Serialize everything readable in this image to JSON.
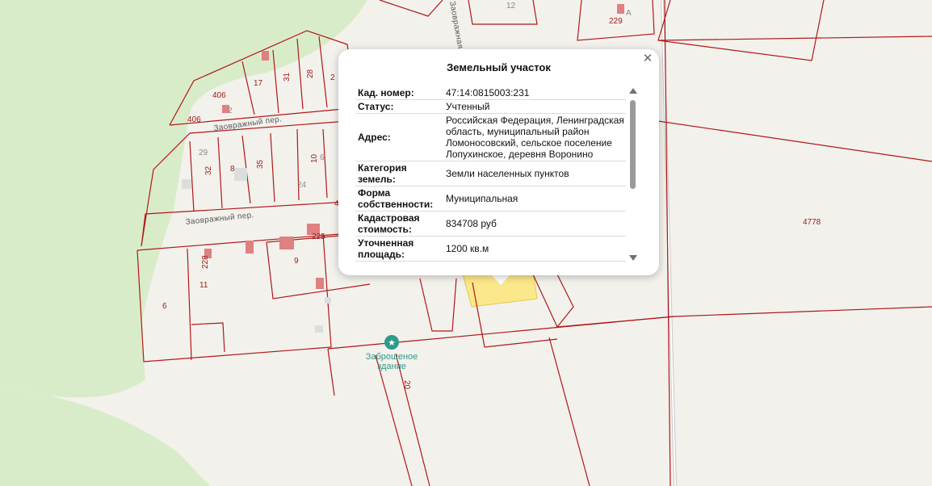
{
  "map": {
    "parcel_numbers": [
      "12",
      "229",
      "А",
      "406",
      "2",
      "17",
      "31",
      "28",
      "2",
      "406",
      "29",
      "32",
      "8",
      "35",
      "10",
      "6",
      "24",
      "4",
      "225",
      "228",
      "9",
      "11",
      "6",
      "20",
      "4778"
    ],
    "streets": [
      "Заовражный пер.",
      "Заовражный пер."
    ],
    "vertical_street": "Заовражная",
    "poi": {
      "name_line1": "Заброшеное",
      "name_line2": "здание",
      "icon": "star-icon"
    }
  },
  "popup": {
    "title": "Земельный участок",
    "close_icon": "close-icon",
    "rows": [
      {
        "label": "Кад. номер:",
        "value": "47:14:0815003:231"
      },
      {
        "label": "Статус:",
        "value": "Учтенный"
      },
      {
        "label": "Адрес:",
        "value": "Российская Федерация, Ленинградская область, муниципальный район Ломоносовский, сельское поселение Лопухинское, деревня Воронино"
      },
      {
        "label": "Категория земель:",
        "value": "Земли населенных пунктов"
      },
      {
        "label": "Форма собственности:",
        "value": "Муниципальная"
      },
      {
        "label": "Кадастровая стоимость:",
        "value": "834708 руб"
      },
      {
        "label": "Уточненная площадь:",
        "value": "1200 кв.м"
      }
    ]
  },
  "colors": {
    "boundary": "#b01818",
    "forest": "#d9ecc9",
    "selected_parcel": "#fbe88a",
    "poi": "#2e9a8a"
  }
}
